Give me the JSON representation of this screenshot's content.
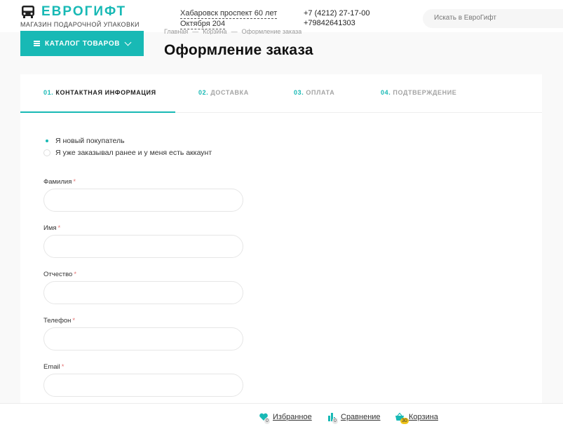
{
  "header": {
    "logo_name": "ЕВРОГИФТ",
    "logo_tagline": "МАГАЗИН ПОДАРОЧНОЙ УПАКОВКИ",
    "address_line1": "Хабаровск проспект 60 лет",
    "address_line2": "Октября 204",
    "phone1": "+7 (4212) 27-17-00",
    "phone2": "+79842641303",
    "search_placeholder": "Искать в ЕвроГифт"
  },
  "breadcrumb": [
    "Главная",
    "Корзина",
    "Оформление заказа"
  ],
  "catalog_label": "КАТАЛОГ ТОВАРОВ",
  "page_title": "Оформление заказа",
  "steps": [
    {
      "num": "01.",
      "label": "КОНТАКТНАЯ ИНФОРМАЦИЯ",
      "active": true
    },
    {
      "num": "02.",
      "label": "ДОСТАВКА",
      "active": false
    },
    {
      "num": "03.",
      "label": "ОПЛАТА",
      "active": false
    },
    {
      "num": "04.",
      "label": "ПОДТВЕРЖДЕНИЕ",
      "active": false
    }
  ],
  "buyer_options": [
    {
      "label": "Я новый покупатель",
      "selected": true
    },
    {
      "label": "Я уже заказывал ранее и у меня есть аккаунт",
      "selected": false
    }
  ],
  "fields": [
    {
      "label": "Фамилия",
      "required": "*",
      "value": ""
    },
    {
      "label": "Имя",
      "required": "*",
      "value": ""
    },
    {
      "label": "Отчество",
      "required": "*",
      "value": ""
    },
    {
      "label": "Телефон",
      "required": "*",
      "value": ""
    },
    {
      "label": "Email",
      "required": "*",
      "value": ""
    }
  ],
  "footer": {
    "favorites_label": "Избранное",
    "favorites_count": "0",
    "compare_label": "Сравнение",
    "compare_count": "0",
    "cart_label": "Корзина",
    "cart_count": "30"
  },
  "colors": {
    "accent": "#18b9b5",
    "required": "#e57373",
    "cart_badge": "#f0c419"
  },
  "icons": {
    "logo": "bus-icon",
    "catalog": "menu-icon",
    "favorites": "heart-icon",
    "compare": "compare-icon",
    "cart": "basket-icon"
  }
}
